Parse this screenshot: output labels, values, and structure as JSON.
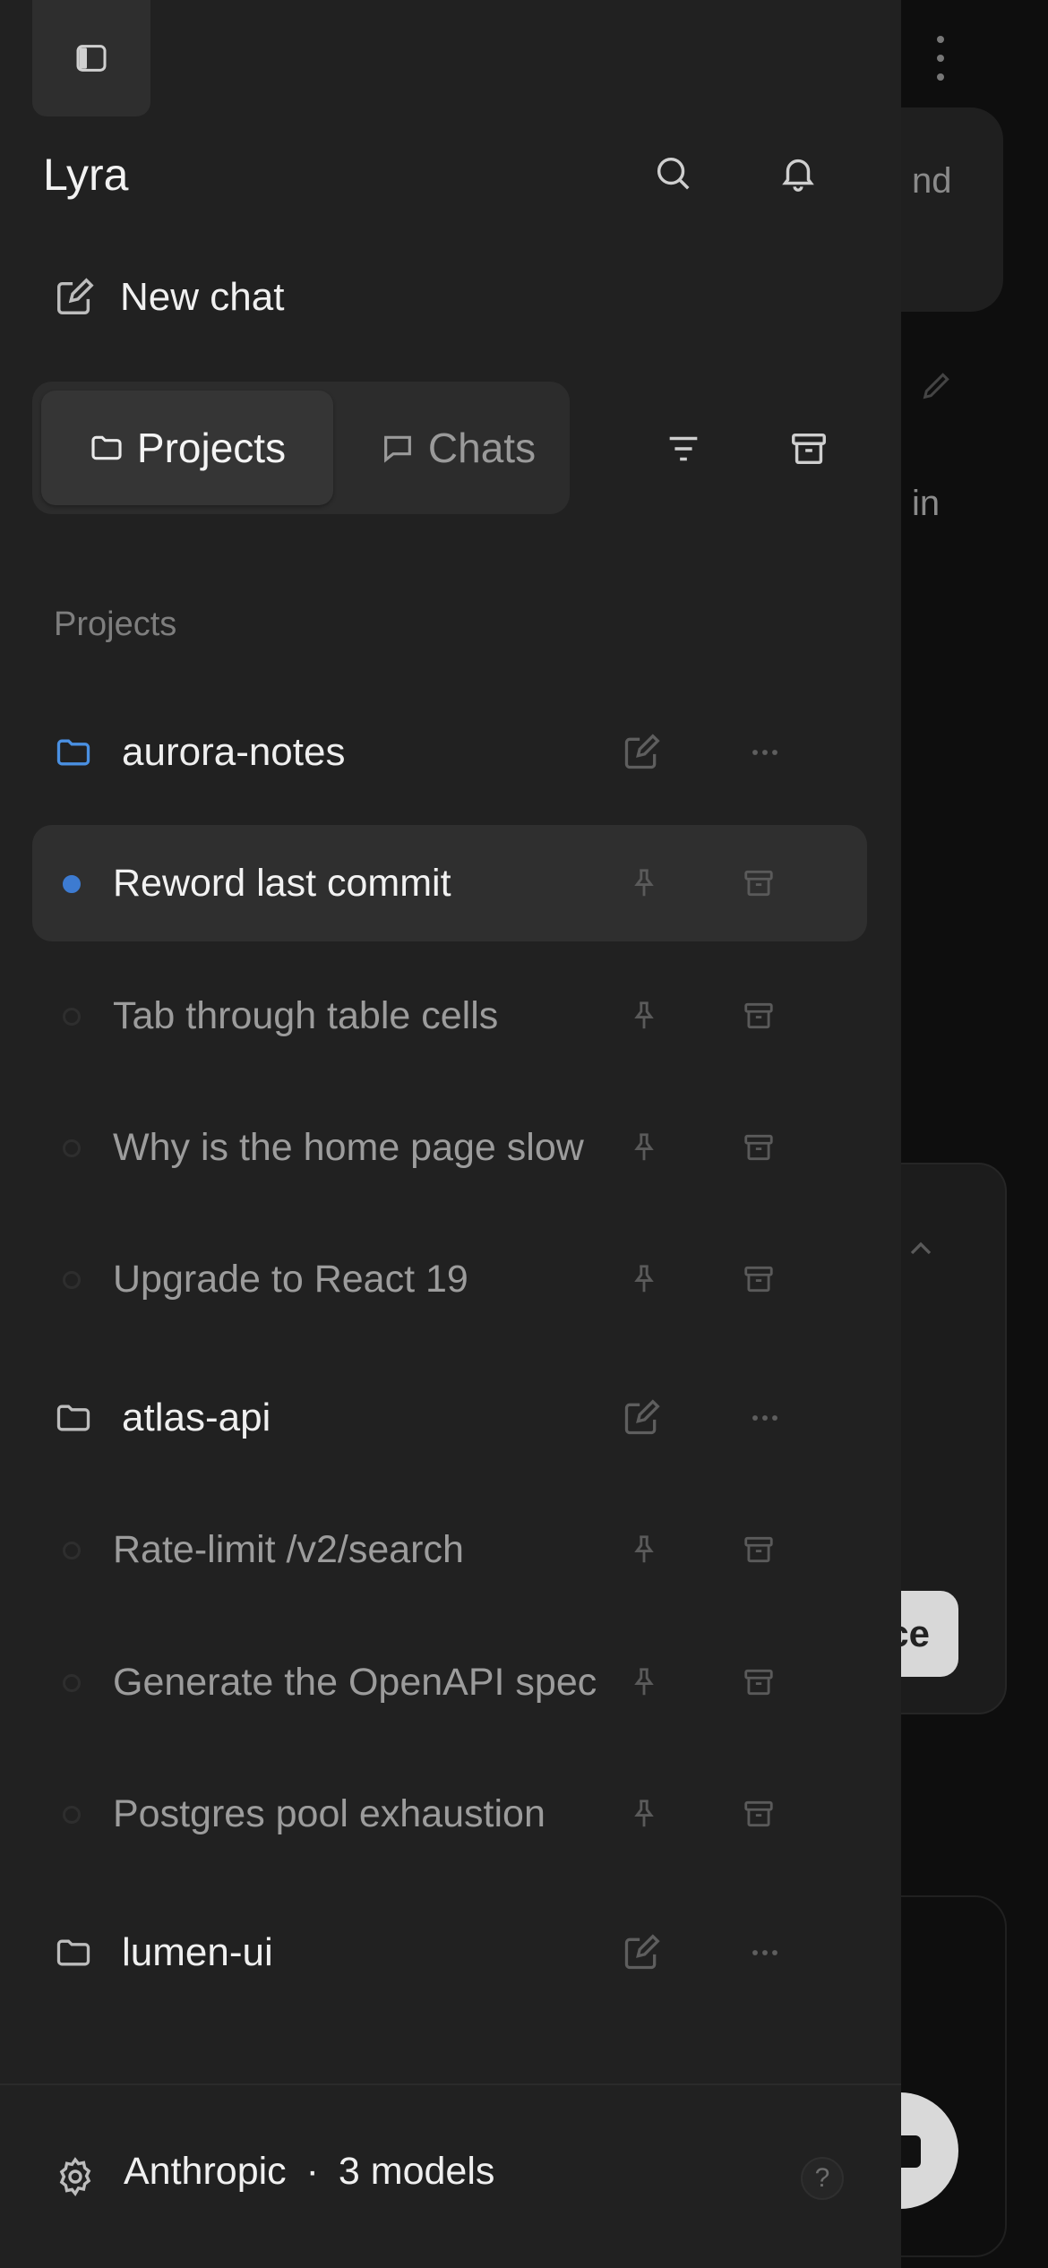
{
  "app": {
    "title": "Lyra"
  },
  "new_chat": {
    "label": "New chat"
  },
  "tabs": [
    {
      "label": "Projects",
      "active": true,
      "icon": "folder-icon"
    },
    {
      "label": "Chats",
      "active": false,
      "icon": "chat-bubble-icon"
    }
  ],
  "section_label": "Projects",
  "projects": [
    {
      "name": "aurora-notes",
      "accent": "#4a90e2",
      "chats": [
        {
          "title": "Reword last commit",
          "selected": true
        },
        {
          "title": "Tab through table cells",
          "selected": false
        },
        {
          "title": "Why is the home page slow",
          "selected": false
        },
        {
          "title": "Upgrade to React 19",
          "selected": false
        }
      ]
    },
    {
      "name": "atlas-api",
      "chats": [
        {
          "title": "Rate-limit /v2/search",
          "selected": false
        },
        {
          "title": "Generate the OpenAPI spec",
          "selected": false
        },
        {
          "title": "Postgres pool exhaustion",
          "selected": false
        }
      ]
    },
    {
      "name": "lumen-ui",
      "chats": []
    }
  ],
  "footer": {
    "provider": "Anthropic",
    "separator": "·",
    "models": "3 models",
    "help": "?"
  },
  "background": {
    "text_1": "nd",
    "text_2": "in",
    "button_fragment": "ce"
  },
  "colors": {
    "drawer": "#212121",
    "selected_row": "#2f2f2f",
    "accent_blue": "#3d7bd1"
  }
}
